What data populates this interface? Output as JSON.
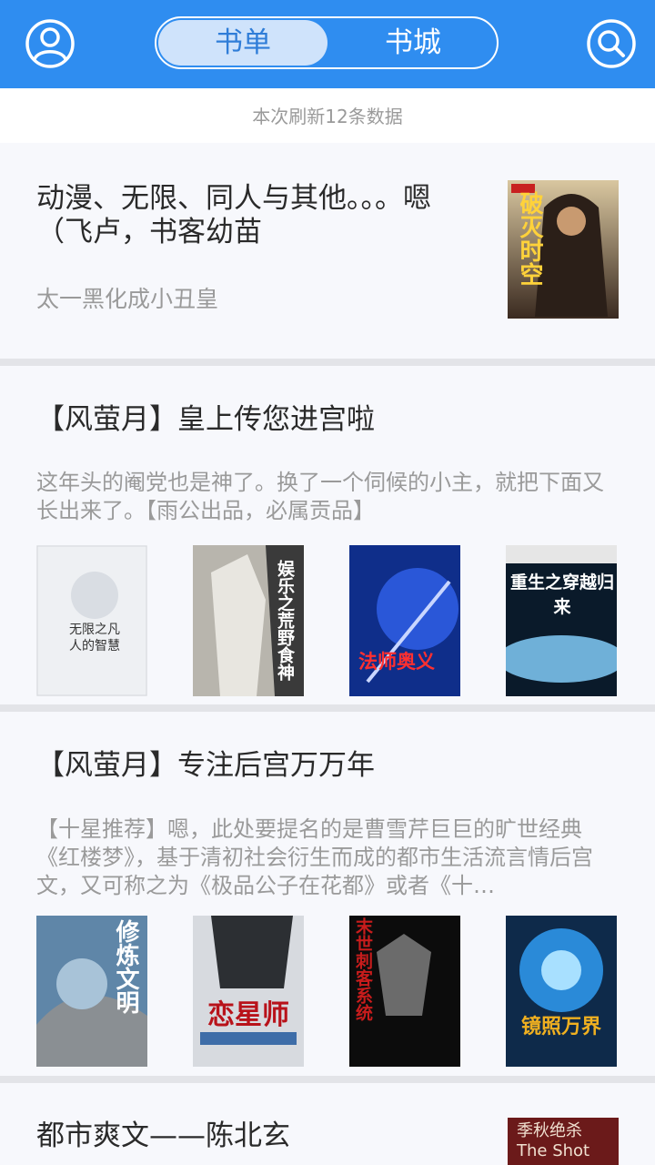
{
  "header": {
    "tabs": [
      {
        "label": "书单",
        "active": true
      },
      {
        "label": "书城",
        "active": false
      }
    ]
  },
  "refresh_notice": "本次刷新12条数据",
  "lists": [
    {
      "title": "动漫、无限、同人与其他。。。嗯（飞卢，书客幼苗",
      "author": "太一黑化成小丑皇",
      "covers": [
        {
          "text": "破灭时空"
        }
      ]
    },
    {
      "title": "【风萤月】皇上传您进宫啦",
      "description": "这年头的阉党也是神了。换了一个伺候的小主，就把下面又长出来了。【雨公出品，必属贡品】",
      "covers": [
        {
          "text": "无限之凡人的智慧"
        },
        {
          "text": "娱乐之荒野食神"
        },
        {
          "text": "法师奥义"
        },
        {
          "text": "重生之穿越归来"
        }
      ]
    },
    {
      "title": "【风萤月】专注后宫万万年",
      "description": "【十星推荐】嗯，此处要提名的是曹雪芹巨巨的旷世经典《红楼梦》，基于清初社会衍生而成的都市生活流言情后宫文，又可称之为《极品公子在花都》或者《十…",
      "covers": [
        {
          "text": "修炼文明"
        },
        {
          "text": "恋星师"
        },
        {
          "text": "末世刺客系统"
        },
        {
          "text": "镜照万界"
        }
      ]
    },
    {
      "title": "都市爽文——陈北玄",
      "covers": [
        {
          "text": "季秋绝杀 The Shot"
        }
      ]
    }
  ],
  "colors": {
    "brand": "#2f8df0",
    "tab_active_bg": "#cfe3fb"
  },
  "icons": {
    "left": "user-avatar-icon",
    "right": "search-icon"
  }
}
